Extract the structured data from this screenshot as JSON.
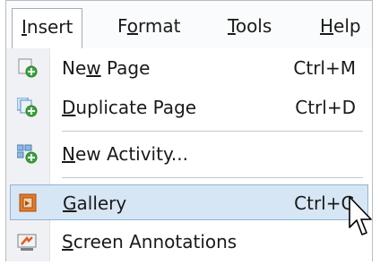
{
  "menubar": {
    "items": [
      {
        "label_pre": "",
        "label_u": "I",
        "label_post": "nsert",
        "active": true
      },
      {
        "label_pre": "F",
        "label_u": "o",
        "label_post": "rmat",
        "active": false
      },
      {
        "label_pre": "",
        "label_u": "T",
        "label_post": "ools",
        "active": false
      },
      {
        "label_pre": "",
        "label_u": "H",
        "label_post": "elp",
        "active": false
      }
    ]
  },
  "menu": {
    "items": [
      {
        "pre": "Ne",
        "u": "w",
        "post": " Page",
        "shortcut": "Ctrl+M",
        "icon": "new-page-icon"
      },
      {
        "pre": "",
        "u": "D",
        "post": "uplicate Page",
        "shortcut": "Ctrl+D",
        "icon": "duplicate-page-icon"
      },
      {
        "pre": "",
        "u": "N",
        "post": "ew Activity...",
        "shortcut": "",
        "icon": "new-activity-icon"
      },
      {
        "pre": "",
        "u": "G",
        "post": "allery",
        "shortcut": "Ctrl+G",
        "icon": "gallery-icon"
      },
      {
        "pre": "",
        "u": "S",
        "post": "creen Annotations",
        "shortcut": "",
        "icon": "screen-annotations-icon"
      }
    ]
  },
  "colors": {
    "highlight_bg": "#d7e6f5",
    "highlight_border": "#8eb4d8",
    "green_plus": "#3aa53a"
  }
}
